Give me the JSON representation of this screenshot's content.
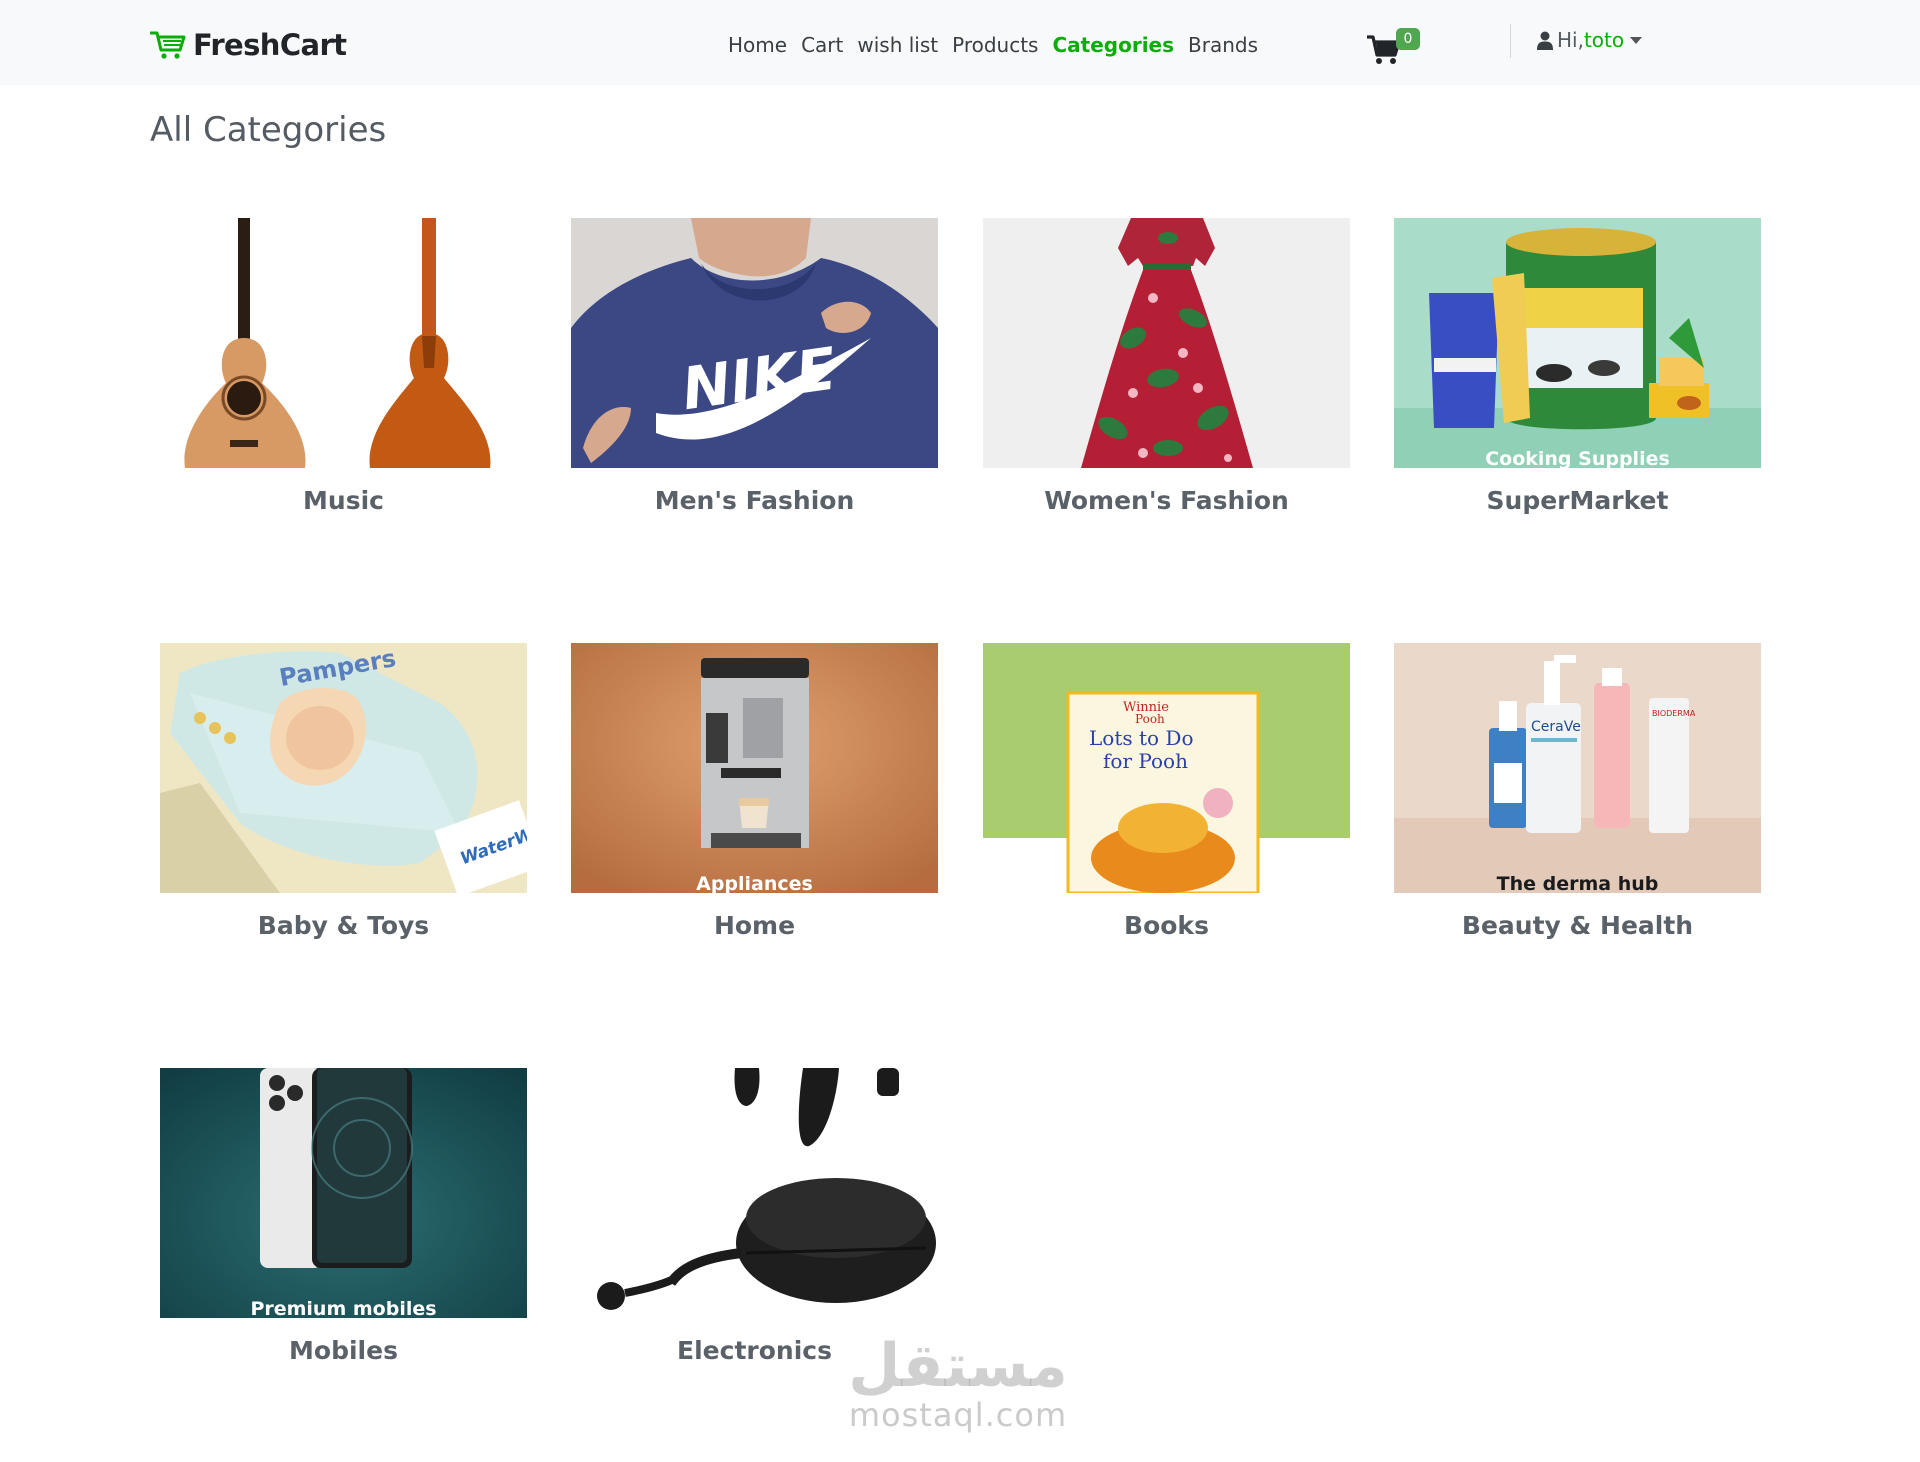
{
  "brand": {
    "name": "FreshCart",
    "color": "#0aad0a"
  },
  "nav": {
    "links": [
      {
        "label": "Home",
        "active": false
      },
      {
        "label": "Cart",
        "active": false
      },
      {
        "label": "wish list",
        "active": false
      },
      {
        "label": "Products",
        "active": false
      },
      {
        "label": "Categories",
        "active": true
      },
      {
        "label": "Brands",
        "active": false
      }
    ],
    "cart": {
      "icon": "cart-icon",
      "count": "0"
    },
    "user": {
      "greeting": "Hi,",
      "name": "toto",
      "icon": "user-icon"
    }
  },
  "page": {
    "title": "All Categories"
  },
  "categories": [
    {
      "name": "Music",
      "image": "guitars-image",
      "caption": ""
    },
    {
      "name": "Men's Fashion",
      "image": "hoodie-image",
      "caption": ""
    },
    {
      "name": "Women's Fashion",
      "image": "dress-image",
      "caption": ""
    },
    {
      "name": "SuperMarket",
      "image": "groceries-image",
      "caption": "Cooking Supplies"
    },
    {
      "name": "Baby & Toys",
      "image": "diapers-image",
      "caption": ""
    },
    {
      "name": "Home",
      "image": "coffee-machine-image",
      "caption": "Appliances"
    },
    {
      "name": "Books",
      "image": "book-image",
      "caption": ""
    },
    {
      "name": "Beauty & Health",
      "image": "skincare-image",
      "caption": "The derma hub"
    },
    {
      "name": "Mobiles",
      "image": "phone-image",
      "caption": "Premium mobiles"
    },
    {
      "name": "Electronics",
      "image": "earbuds-image",
      "caption": ""
    }
  ],
  "watermark": {
    "arabic": "مستقل",
    "latin": "mostaql.com"
  }
}
